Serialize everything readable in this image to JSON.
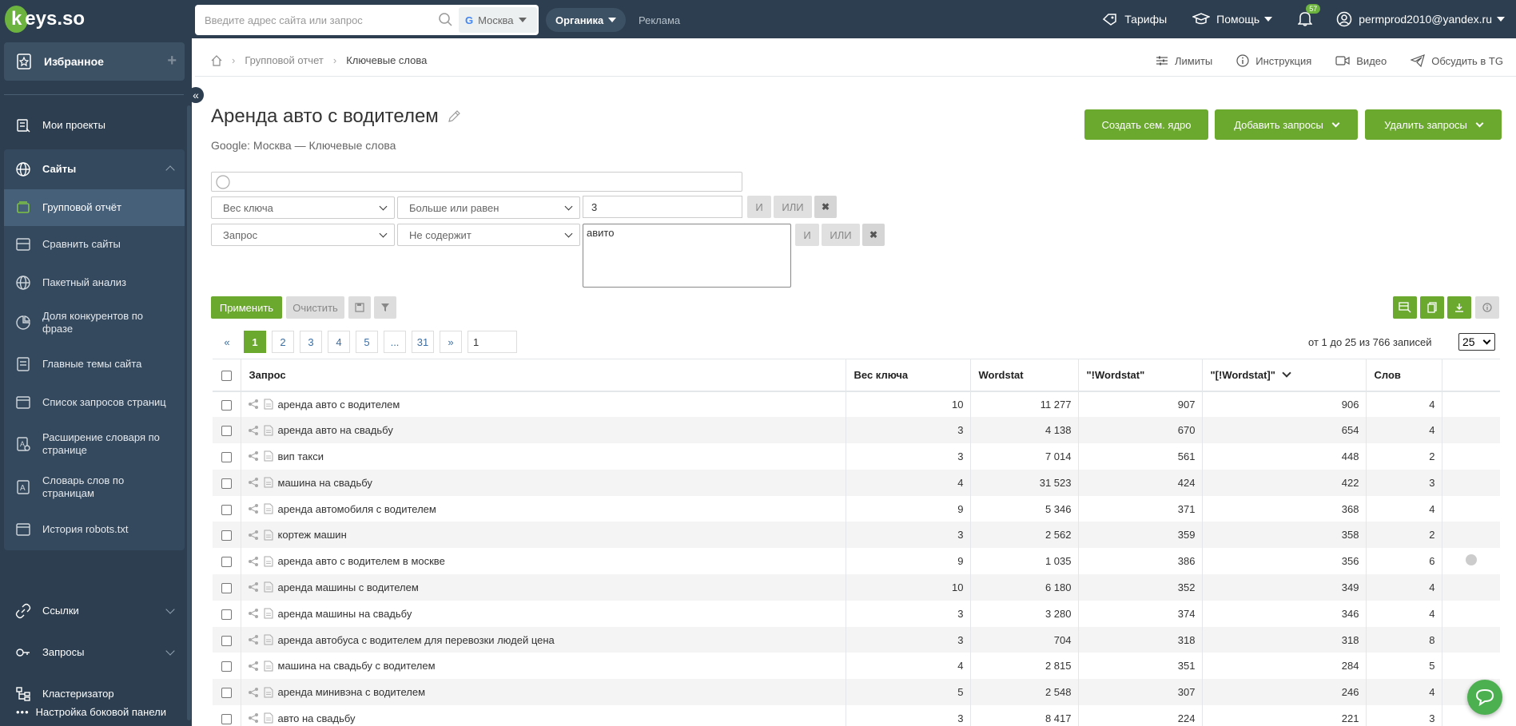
{
  "header": {
    "logo_text": "keys.so",
    "search_placeholder": "Введите адрес сайта или запрос",
    "region": "Москва",
    "tab_organic": "Органика",
    "tab_ads": "Реклама",
    "tariffs": "Тарифы",
    "help": "Помощь",
    "notifications_count": "57",
    "user_email": "permprod2010@yandex.ru"
  },
  "sidebar": {
    "favorites": "Избранное",
    "items": [
      {
        "label": "Мои проекты"
      },
      {
        "label": "Сайты"
      },
      {
        "label": "Групповой отчёт"
      },
      {
        "label": "Сравнить сайты"
      },
      {
        "label": "Пакетный анализ"
      },
      {
        "label": "Доля конкурентов по фразе"
      },
      {
        "label": "Главные темы сайта"
      },
      {
        "label": "Список запросов страниц"
      },
      {
        "label": "Расширение словаря по странице"
      },
      {
        "label": "Словарь слов по страницам"
      },
      {
        "label": "История robots.txt"
      },
      {
        "label": "Ссылки"
      },
      {
        "label": "Запросы"
      },
      {
        "label": "Кластеризатор"
      }
    ],
    "settings": "Настройка боковой панели"
  },
  "breadcrumb": {
    "group_report": "Групповой отчет",
    "keywords": "Ключевые слова",
    "limits": "Лимиты",
    "instruction": "Инструкция",
    "video": "Видео",
    "discuss": "Обсудить в TG"
  },
  "page": {
    "title": "Аренда авто с водителем",
    "subtitle": "Google: Москва — Ключевые слова",
    "btn_create_core": "Создать сем. ядро",
    "btn_add_queries": "Добавить запросы",
    "btn_delete_queries": "Удалить запросы"
  },
  "filters": {
    "row1_field": "Вес ключа",
    "row1_op": "Больше или равен",
    "row1_value": "3",
    "row2_field": "Запрос",
    "row2_op": "Не содержит",
    "row2_value": "авито",
    "and_label": "И",
    "or_label": "ИЛИ",
    "apply": "Применить",
    "clear": "Очистить"
  },
  "pagination": {
    "prev": "«",
    "pages": [
      "1",
      "2",
      "3",
      "4",
      "5",
      "...",
      "31"
    ],
    "next": "»",
    "goto_value": "1",
    "records_text": "от 1 до 25 из 766 записей",
    "per_page": "25"
  },
  "table": {
    "headers": {
      "query": "Запрос",
      "weight": "Вес ключа",
      "wordstat": "Wordstat",
      "excl_wordstat": "\"!Wordstat\"",
      "brackets_wordstat": "\"[!Wordstat]\"",
      "words": "Слов"
    },
    "rows": [
      {
        "query": "аренда авто с водителем",
        "weight": "10",
        "wordstat": "11 277",
        "excl": "907",
        "brackets": "906",
        "words": "4"
      },
      {
        "query": "аренда авто на свадьбу",
        "weight": "3",
        "wordstat": "4 138",
        "excl": "670",
        "brackets": "654",
        "words": "4"
      },
      {
        "query": "вип такси",
        "weight": "3",
        "wordstat": "7 014",
        "excl": "561",
        "brackets": "448",
        "words": "2"
      },
      {
        "query": "машина на свадьбу",
        "weight": "4",
        "wordstat": "31 523",
        "excl": "424",
        "brackets": "422",
        "words": "3"
      },
      {
        "query": "аренда автомобиля с водителем",
        "weight": "9",
        "wordstat": "5 346",
        "excl": "371",
        "brackets": "368",
        "words": "4"
      },
      {
        "query": "кортеж машин",
        "weight": "3",
        "wordstat": "2 562",
        "excl": "359",
        "brackets": "358",
        "words": "2"
      },
      {
        "query": "аренда авто с водителем в москве",
        "weight": "9",
        "wordstat": "1 035",
        "excl": "386",
        "brackets": "356",
        "words": "6"
      },
      {
        "query": "аренда машины с водителем",
        "weight": "10",
        "wordstat": "6 180",
        "excl": "352",
        "brackets": "349",
        "words": "4"
      },
      {
        "query": "аренда машины на свадьбу",
        "weight": "3",
        "wordstat": "3 280",
        "excl": "374",
        "brackets": "346",
        "words": "4"
      },
      {
        "query": "аренда автобуса с водителем для перевозки людей цена",
        "weight": "3",
        "wordstat": "704",
        "excl": "318",
        "brackets": "318",
        "words": "8"
      },
      {
        "query": "машина на свадьбу с водителем",
        "weight": "4",
        "wordstat": "2 815",
        "excl": "351",
        "brackets": "284",
        "words": "5"
      },
      {
        "query": "аренда минивэна с водителем",
        "weight": "5",
        "wordstat": "2 548",
        "excl": "307",
        "brackets": "246",
        "words": "4"
      },
      {
        "query": "авто на свадьбу",
        "weight": "3",
        "wordstat": "8 417",
        "excl": "224",
        "brackets": "221",
        "words": "3"
      }
    ]
  },
  "colors": {
    "topbar": "#2c3e50",
    "accent_green": "#6aa82e",
    "link_blue": "#3a6ea5"
  }
}
